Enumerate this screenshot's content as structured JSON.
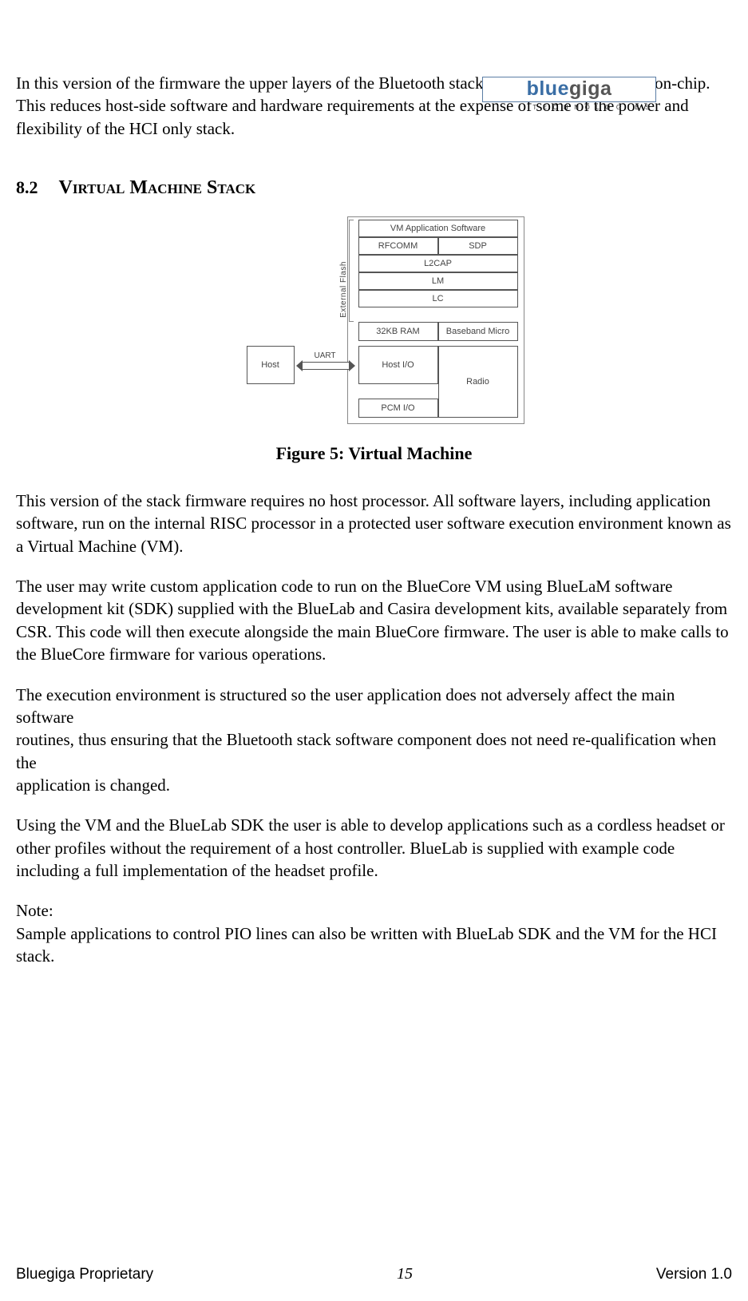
{
  "brand": {
    "name_first": "blue",
    "name_second": "giga",
    "tagline": "TECHNOLOGIES"
  },
  "intro_paragraph": "In this version of the firmware the upper layers of the Bluetooth stack up to RFCOMM are run on-chip. This reduces host-side software and hardware requirements at the expense of some of the power and flexibility of the HCI only stack.",
  "section": {
    "number": "8.2",
    "title": "Virtual Machine Stack"
  },
  "diagram": {
    "flash_label": "External Flash",
    "vm_app": "VM Application Software",
    "rfcomm": "RFCOMM",
    "sdp": "SDP",
    "l2cap": "L2CAP",
    "lm": "LM",
    "lc": "LC",
    "ram": "32KB RAM",
    "baseband": "Baseband Micro",
    "host": "Host",
    "uart": "UART",
    "host_io": "Host I/O",
    "radio": "Radio",
    "pcm": "PCM I/O"
  },
  "figure_caption": "Figure 5: Virtual Machine",
  "paragraphs": {
    "p1": "This version of the stack firmware requires no host processor. All software layers, including application software, run on the internal RISC processor in a protected user software execution environment known as a Virtual Machine (VM).",
    "p2": "The user may write custom application code to run on the BlueCore VM using BlueLaM software development kit (SDK) supplied with the BlueLab and Casira development kits, available separately from CSR. This code will then execute alongside the main BlueCore firmware. The user is able to make calls to the BlueCore firmware for various operations.",
    "p3": "The execution environment is structured so the user application does not adversely affect the main software\nroutines, thus ensuring that the Bluetooth stack software component does not need re-qualification when the\napplication is changed.",
    "p4": "Using the VM and the BlueLab SDK the user is able to develop applications such as a cordless headset or other profiles without the requirement of a host controller. BlueLab is supplied with example code including a full implementation of the headset profile.",
    "p5": "Note:\nSample applications to control PIO lines can also be written with BlueLab SDK and the VM for the HCI stack."
  },
  "footer": {
    "left": "Bluegiga Proprietary",
    "center": "15",
    "right": "Version 1.0"
  }
}
